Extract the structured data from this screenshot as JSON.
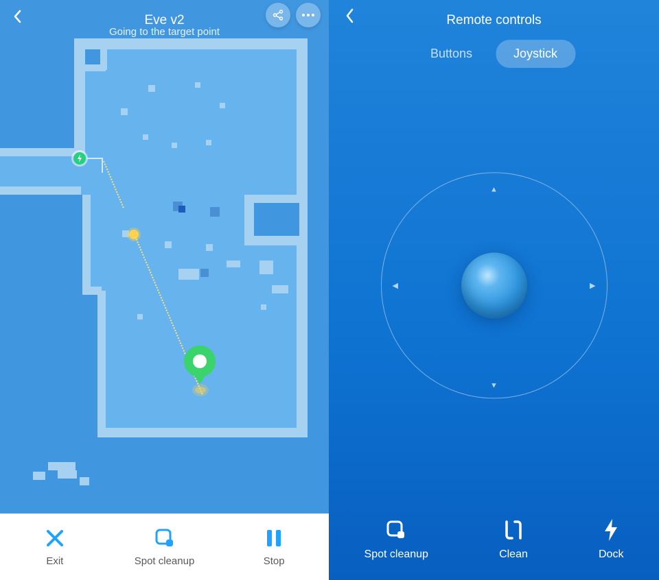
{
  "left": {
    "title": "Eve v2",
    "status": "Going to the target point",
    "actions": {
      "exit": "Exit",
      "spot": "Spot cleanup",
      "stop": "Stop"
    }
  },
  "right": {
    "title": "Remote controls",
    "tabs": {
      "buttons": "Buttons",
      "joystick": "Joystick"
    },
    "active_tab": "joystick",
    "actions": {
      "spot": "Spot cleanup",
      "clean": "Clean",
      "dock": "Dock"
    }
  }
}
